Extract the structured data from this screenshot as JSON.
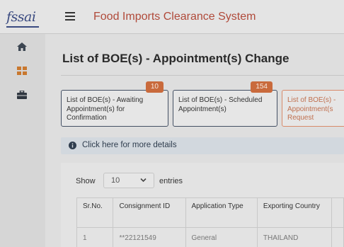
{
  "header": {
    "logo_text": "fssai",
    "app_title": "Food Imports Clearance System"
  },
  "page": {
    "title": "List of BOE(s) - Appointment(s) Change"
  },
  "cards": [
    {
      "label": "List of BOE(s) - Awaiting Appointment(s) for Confirmation",
      "badge": "10"
    },
    {
      "label": "List of BOE(s) - Scheduled Appointment(s)",
      "badge": "154"
    },
    {
      "label": "List of BOE(s) - Appointment(s Request",
      "badge": ""
    }
  ],
  "info": {
    "text": "Click here for more details"
  },
  "table_controls": {
    "show_label": "Show",
    "page_size": "10",
    "entries_label": "entries"
  },
  "table": {
    "headers": [
      "Sr.No.",
      "Consignment ID",
      "Application Type",
      "Exporting Country"
    ],
    "rows": [
      [
        "1",
        "**22121549",
        "General",
        "THAILAND"
      ]
    ]
  },
  "colors": {
    "title_accent": "#b04a3a",
    "badge": "#c96a3c",
    "card_border": "#445064",
    "active_card_border": "#d88a6a",
    "info_bar": "#d2d8de"
  },
  "icons": [
    "hamburger-icon",
    "home-icon",
    "grid-icon",
    "briefcase-icon",
    "info-icon",
    "chevron-down-icon"
  ]
}
